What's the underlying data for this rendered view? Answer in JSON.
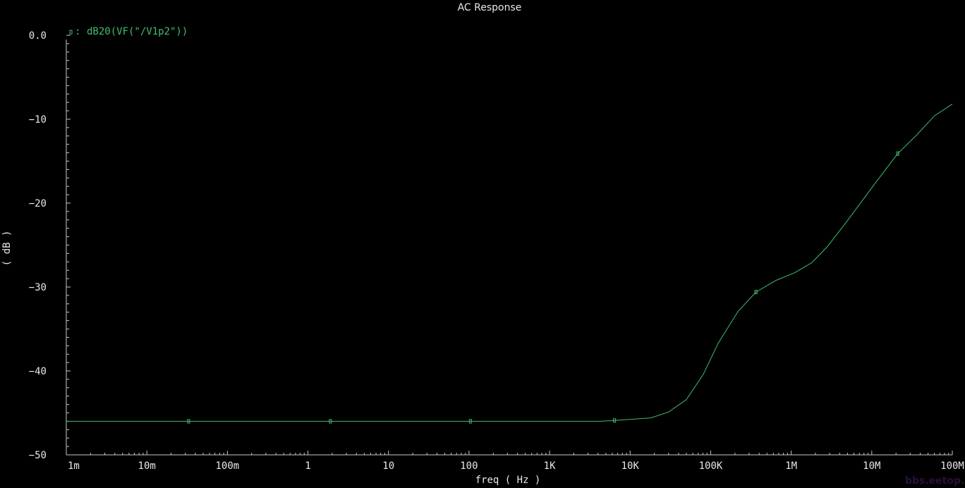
{
  "chart_data": {
    "type": "line",
    "title": "AC Response",
    "xlabel": "freq ( Hz )",
    "ylabel": "( dB )",
    "xscale": "log",
    "xlim": [
      0.001,
      100000000
    ],
    "ylim": [
      -50,
      0
    ],
    "x_tick_labels": [
      "1m",
      "10m",
      "100m",
      "1",
      "10",
      "100",
      "1K",
      "10K",
      "100K",
      "1M",
      "10M",
      "100M"
    ],
    "x_tick_values": [
      0.001,
      0.01,
      0.1,
      1,
      10,
      100,
      1000,
      10000,
      100000,
      1000000,
      10000000,
      100000000
    ],
    "y_tick_labels": [
      "0.0",
      "-10",
      "-20",
      "-30",
      "-40",
      "-50"
    ],
    "y_tick_values": [
      0,
      -10,
      -20,
      -30,
      -40,
      -50
    ],
    "grid": false,
    "legend_placement": "top-left",
    "series": [
      {
        "name": "dB20(VF(\"/V1p2\"))",
        "color": "#3fbf6f",
        "x": [
          0.001,
          0.033,
          1.9,
          104,
          4200,
          6400,
          18000,
          30000,
          50000,
          81000,
          124000,
          219000,
          365000,
          650000,
          1100000,
          1800000,
          2800000,
          4800000,
          10700000,
          21000000,
          36000000,
          60000000,
          100000000
        ],
        "y": [
          -46.0,
          -46.0,
          -46.0,
          -46.0,
          -46.0,
          -45.9,
          -45.6,
          -44.9,
          -43.4,
          -40.4,
          -36.7,
          -32.9,
          -30.6,
          -29.2,
          -28.3,
          -27.1,
          -25.2,
          -22.3,
          -17.8,
          -14.1,
          -11.9,
          -9.6,
          -8.2
        ],
        "markers_x": [
          0.033,
          1.9,
          104,
          6400,
          365000,
          21000000
        ]
      }
    ]
  },
  "colors": {
    "background": "#000000",
    "axis": "#c8c8c8",
    "text": "#e8e8e8",
    "trace": "#3fbf6f"
  },
  "watermark": "bbs.eetop.cn"
}
